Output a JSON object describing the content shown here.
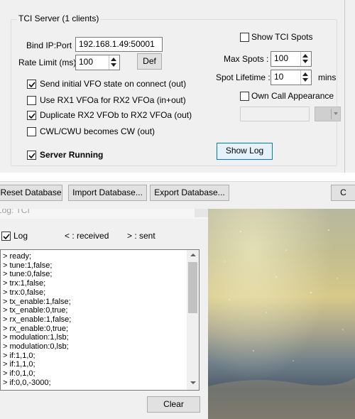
{
  "tci_group": {
    "title": "TCI Server (1 clients)",
    "bind_label": "Bind IP:Port",
    "bind_value": "192.168.1.49:50001",
    "rate_label": "Rate Limit (ms)",
    "rate_value": "100",
    "def_label": "Def",
    "options": [
      {
        "label": "Send initial VFO state on connect (out)",
        "checked": true
      },
      {
        "label": "Use RX1 VFOa for RX2 VFOa (in+out)",
        "checked": false
      },
      {
        "label": "Duplicate RX2 VFOb to RX2 VFOa (out)",
        "checked": true
      },
      {
        "label": "CWL/CWU becomes CW (out)",
        "checked": false
      }
    ],
    "server_running_label": "Server Running",
    "server_running_checked": true,
    "show_tci_spots_label": "Show TCI Spots",
    "show_tci_spots_checked": false,
    "max_spots_label": "Max Spots :",
    "max_spots_value": "100",
    "spot_lifetime_label": "Spot Lifetime :",
    "spot_lifetime_value": "10",
    "mins_label": "mins",
    "own_call_label": "Own Call Appearance",
    "own_call_checked": false,
    "show_log_label": "Show Log"
  },
  "database_bar": {
    "reset_label": "Reset Database",
    "import_label": "Import Database...",
    "export_label": "Export Database...",
    "cut_label": "C"
  },
  "log_window": {
    "title": "Log: TCI",
    "log_label": "Log",
    "log_checked": true,
    "received_label": "< : received",
    "sent_label": "> : sent",
    "lines": [
      "> ready;",
      "> tune:1,false;",
      "> tune:0,false;",
      "> trx:1,false;",
      "> trx:0,false;",
      "> tx_enable:1,false;",
      "> tx_enable:0,true;",
      "> rx_enable:1,false;",
      "> rx_enable:0,true;",
      "> modulation:1,lsb;",
      "> modulation:0,lsb;",
      "> if:1,1,0;",
      "> if:1,1,0;",
      "> if:0,1,0;",
      "> if:0,0,-3000;"
    ],
    "clear_label": "Clear"
  },
  "colors": {
    "window_bg": "#f0f0f0",
    "groupbox_border": "#dcdcdc",
    "button_bg": "#e1e1e1",
    "focus_button_border": "#0078d7"
  }
}
